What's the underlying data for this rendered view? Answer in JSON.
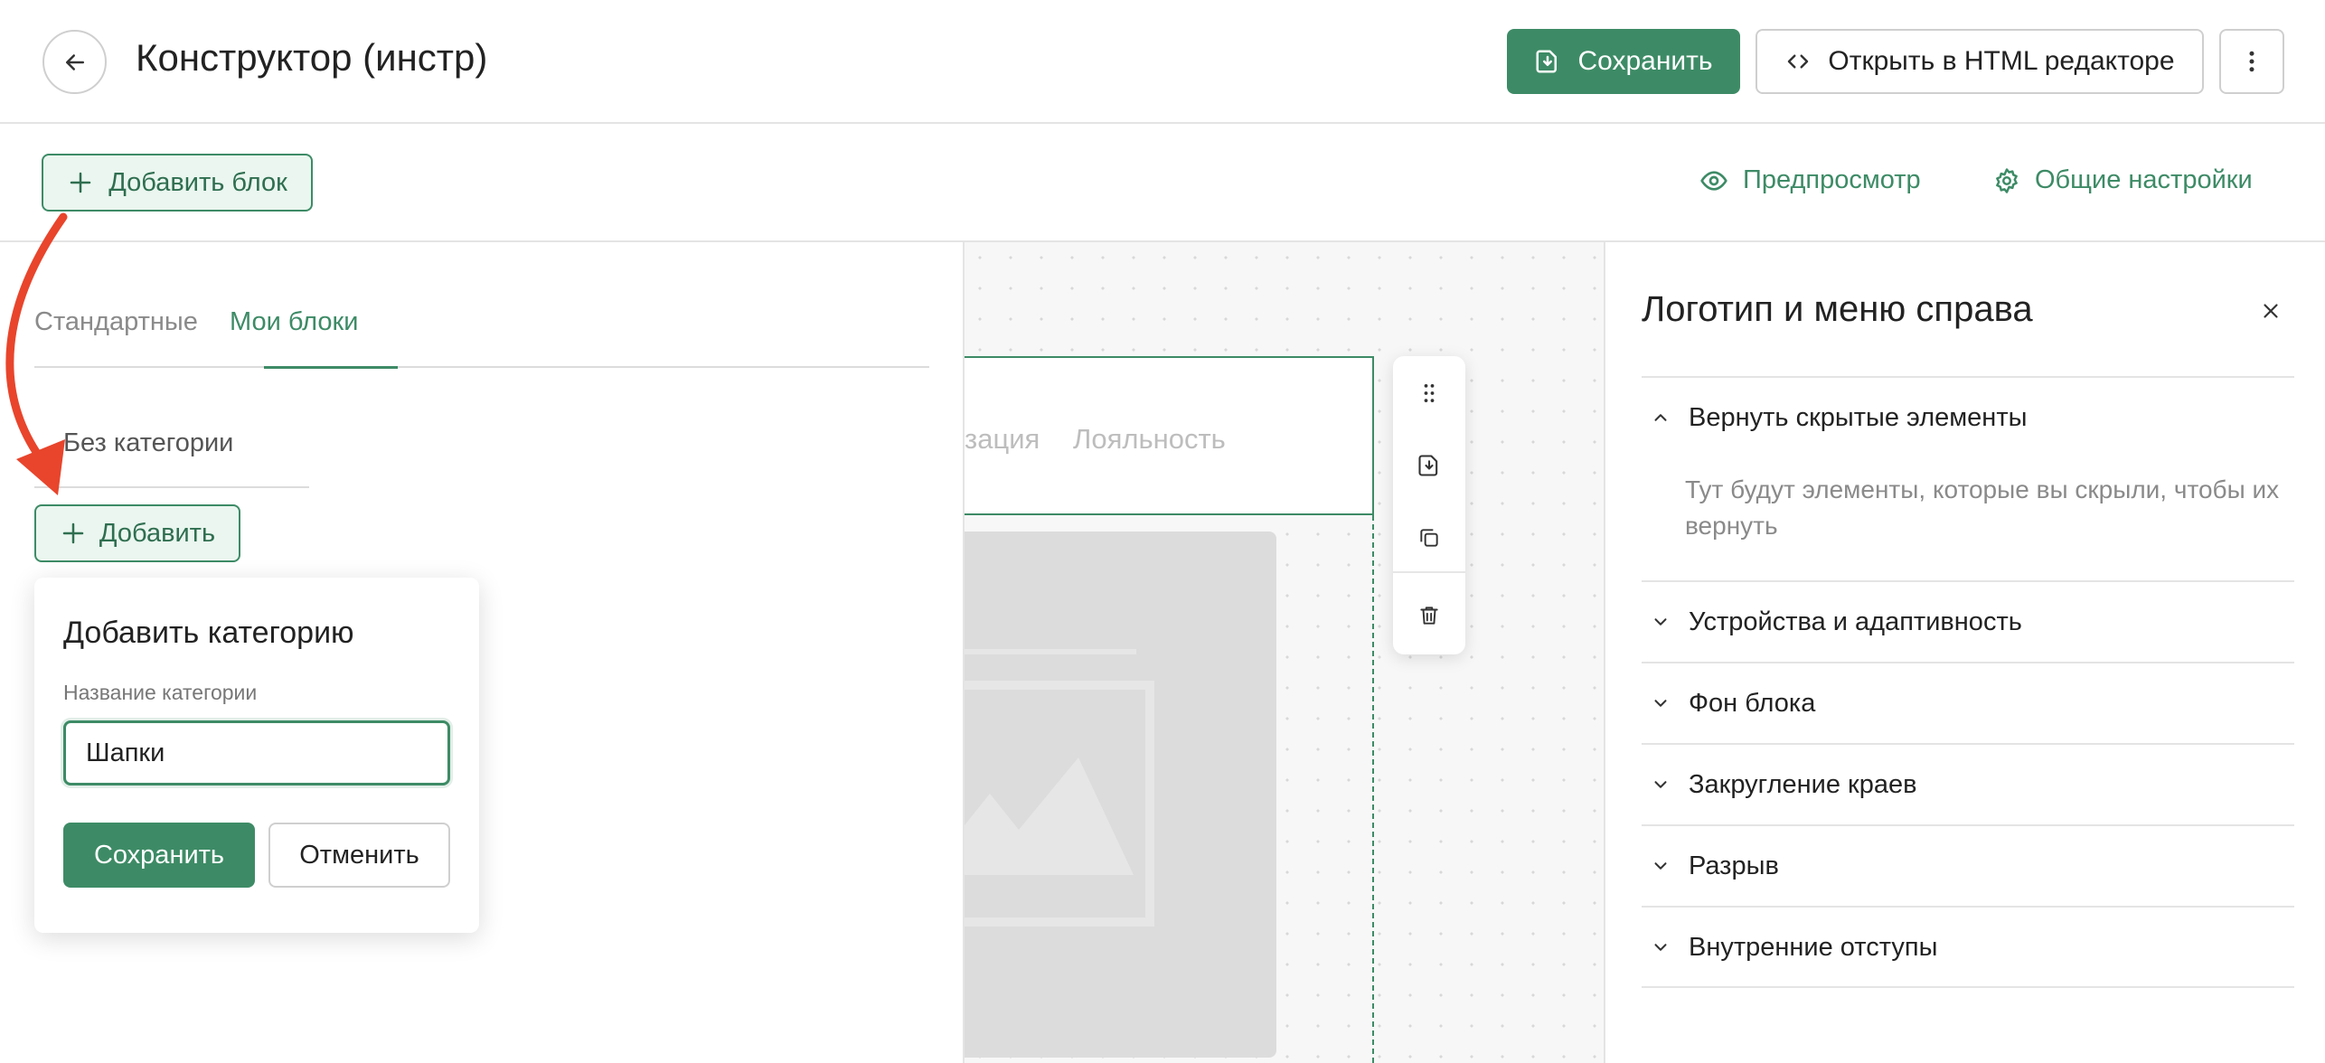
{
  "header": {
    "title": "Конструктор (инстр)",
    "save_label": "Сохранить",
    "html_editor_label": "Открыть в HTML редакторе"
  },
  "toolbar": {
    "add_block_label": "Добавить блок",
    "preview_label": "Предпросмотр",
    "settings_label": "Общие настройки"
  },
  "left_panel": {
    "tabs": [
      "Стандартные",
      "Мои блоки"
    ],
    "active_tab": "Мои блоки",
    "category": "Без категории",
    "add_label": "Добавить",
    "popover": {
      "title": "Добавить категорию",
      "field_label": "Название категории",
      "field_value": "Шапки",
      "save_label": "Сохранить",
      "cancel_label": "Отменить"
    }
  },
  "canvas": {
    "nav_items": [
      "зация",
      "Лояльность"
    ]
  },
  "right_panel": {
    "title": "Логотип и меню справа",
    "sections": [
      {
        "label": "Вернуть скрытые элементы",
        "expanded": true,
        "body": "Тут будут элементы, которые вы скрыли, чтобы их вернуть"
      },
      {
        "label": "Устройства и адаптивность",
        "expanded": false
      },
      {
        "label": "Фон блока",
        "expanded": false
      },
      {
        "label": "Закругление краев",
        "expanded": false
      },
      {
        "label": "Разрыв",
        "expanded": false
      },
      {
        "label": "Внутренние отступы",
        "expanded": false
      }
    ]
  },
  "colors": {
    "accent": "#3d8b66",
    "accent_light": "#eaf6ef",
    "annotation_arrow": "#e8452c"
  }
}
